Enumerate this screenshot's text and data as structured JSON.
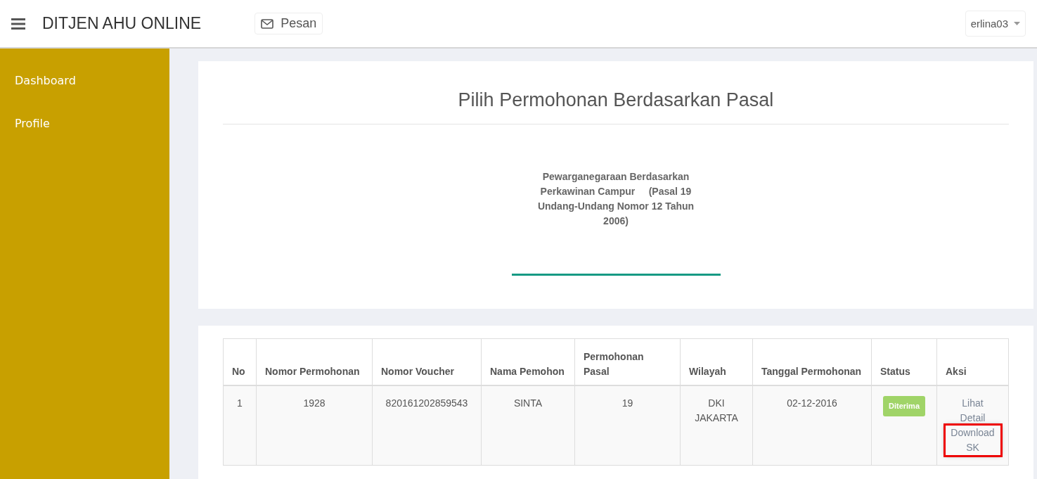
{
  "header": {
    "brand": "DITJEN AHU ONLINE",
    "message_button": "Pesan",
    "user_menu": "erlina03"
  },
  "sidebar": {
    "items": [
      {
        "label": "Dashboard",
        "selected": false
      },
      {
        "label": "Profile",
        "selected": false
      }
    ]
  },
  "selection_card": {
    "title": "Pilih Permohonan Berdasarkan Pasal",
    "option": "Pewarganegaraan Berdasarkan Perkawinan Campur     (Pasal 19 Undang-Undang Nomor 12 Tahun 2006)"
  },
  "table": {
    "columns": [
      "No",
      "Nomor Permohonan",
      "Nomor Voucher",
      "Nama Pemohon",
      "Permohonan Pasal",
      "Wilayah",
      "Tanggal Permohonan",
      "Status",
      "Aksi"
    ],
    "rows": [
      {
        "cells": [
          "1",
          "1928",
          "820161202859543",
          "SINTA",
          "19",
          "DKI JAKARTA",
          "02-12-2016"
        ],
        "status": {
          "label": "Diterima",
          "color": "#a0d468"
        },
        "actions": [
          {
            "label": "Lihat Detail",
            "highlighted": false
          },
          {
            "label": "Download SK",
            "highlighted": true
          }
        ]
      }
    ]
  }
}
